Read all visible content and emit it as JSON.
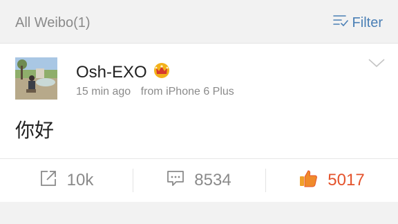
{
  "header": {
    "title": "All Weibo(1)",
    "filter_label": "Filter",
    "filter_icon": "filter-icon"
  },
  "post": {
    "username": "Osh-EXO",
    "badge_icon": "crown-icon",
    "time": "15 min ago",
    "source": "from iPhone 6 Plus",
    "text": "你好",
    "menu_icon": "chevron-down-icon"
  },
  "actions": {
    "repost": {
      "icon": "repost-icon",
      "count": "10k"
    },
    "comment": {
      "icon": "comment-icon",
      "count": "8534"
    },
    "like": {
      "icon": "thumbs-up-icon",
      "count": "5017",
      "active_color": "#e4532c"
    }
  },
  "colors": {
    "accent": "#4a7fb5",
    "like": "#e4532c",
    "crown": "#f3b11a"
  }
}
